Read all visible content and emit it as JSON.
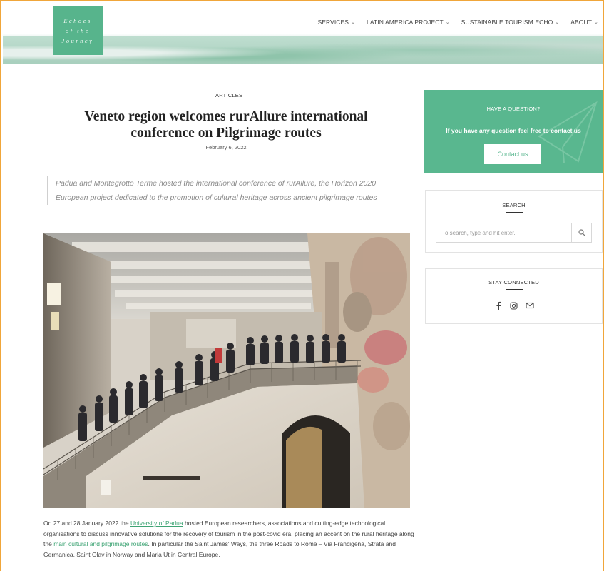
{
  "header": {
    "logo_lines": [
      "Echoes",
      "of the",
      "Journey"
    ],
    "nav": [
      {
        "label": "SERVICES",
        "has_dropdown": true
      },
      {
        "label": "LATIN AMERICA PROJECT",
        "has_dropdown": true
      },
      {
        "label": "SUSTAINABLE TOURISM ECHO",
        "has_dropdown": true
      },
      {
        "label": "ABOUT",
        "has_dropdown": true
      }
    ]
  },
  "article": {
    "category": "ARTICLES",
    "title": "Veneto region welcomes rurAllure international conference on Pilgrimage routes",
    "date": "February 6, 2022",
    "lead": "Padua and Montegrotto Terme hosted the international conference of rurAllure, the Horizon 2020 European project dedicated to the promotion of cultural heritage across ancient pilgrimage routes",
    "body": {
      "p1_before": "On 27 and 28 January 2022 the ",
      "link1": "University of Padua",
      "p1_middle": " hosted European researchers, associations and cutting-edge technological organisations to discuss innovative solutions for the recovery of tourism in the post-covid era, placing an accent on the rural heritage along the ",
      "link2": "main cultural and pilgrimage routes",
      "p1_after": ". In particular the Saint James' Ways, the three Roads to Rome – Via Francigena, Strata and Germanica, Saint Olav in Norway and Maria Ut in Central Europe."
    }
  },
  "sidebar": {
    "cta": {
      "title": "HAVE A QUESTION?",
      "text": "If you have any question feel free to contact us",
      "button": "Contact us"
    },
    "search": {
      "title": "SEARCH",
      "placeholder": "To search, type and hit enter."
    },
    "social": {
      "title": "STAY CONNECTED",
      "icons": [
        "facebook-icon",
        "instagram-icon",
        "email-icon"
      ]
    }
  },
  "colors": {
    "accent": "#59b78f",
    "link": "#3ea474",
    "frame": "#f0a63a"
  }
}
